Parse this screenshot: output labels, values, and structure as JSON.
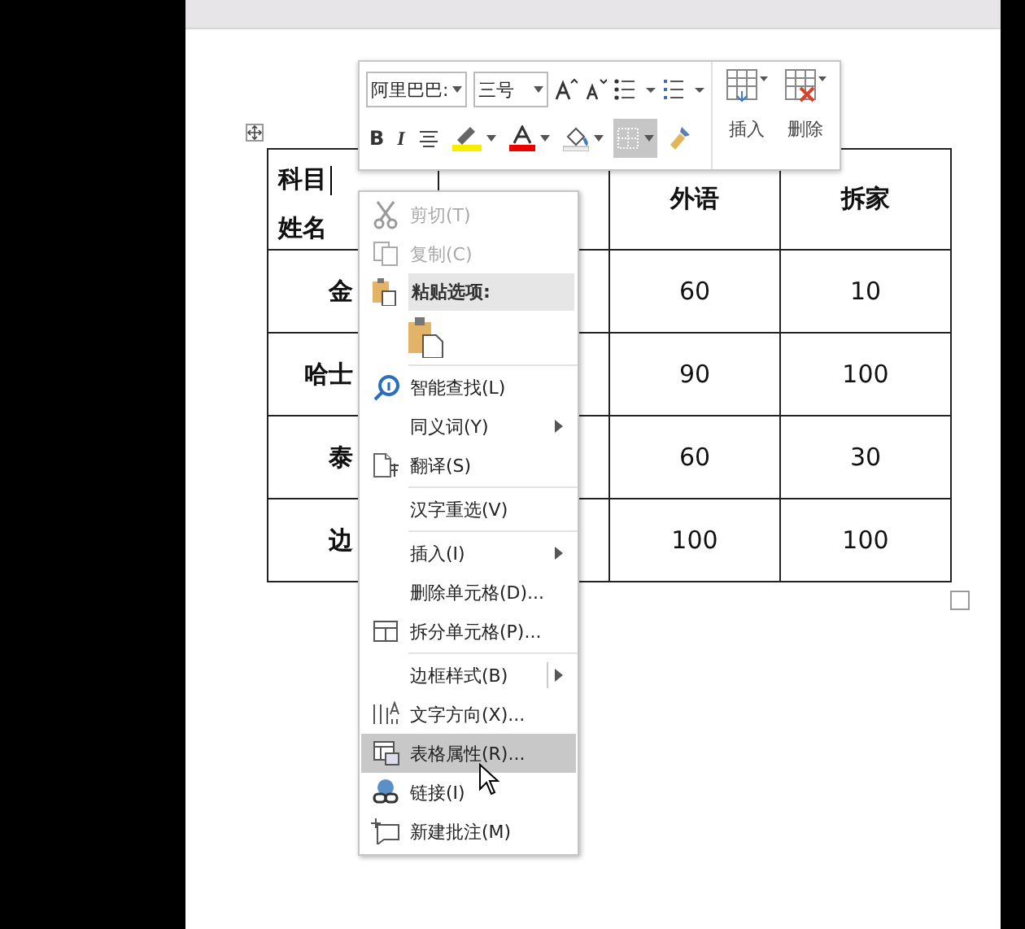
{
  "toolbar": {
    "font_name": "阿里巴巴:",
    "font_size": "三号",
    "format_buttons": [
      {
        "kind": "bold",
        "label": "B",
        "selected": false
      },
      {
        "kind": "italic",
        "label": "I",
        "selected": false
      },
      {
        "kind": "align",
        "selected": false
      },
      {
        "kind": "highlight",
        "selected": false
      },
      {
        "kind": "font-color",
        "selected": false
      },
      {
        "kind": "shading",
        "selected": false
      },
      {
        "kind": "borders",
        "selected": true
      },
      {
        "kind": "painter",
        "selected": false
      }
    ],
    "insert_label": "插入",
    "delete_label": "删除"
  },
  "table": {
    "corner_top": "科目",
    "corner_bottom": "姓名",
    "columns": [
      "外语",
      "拆家"
    ],
    "rows": [
      {
        "name": "金",
        "scores": [
          "60",
          "10"
        ]
      },
      {
        "name": "哈士",
        "scores": [
          "90",
          "100"
        ]
      },
      {
        "name": "泰",
        "scores": [
          "60",
          "30"
        ]
      },
      {
        "name": "边",
        "scores": [
          "100",
          "100"
        ]
      }
    ]
  },
  "context_menu": {
    "items": [
      {
        "kind": "cut",
        "label": "剪切(T)",
        "disabled": true,
        "selected": false
      },
      {
        "kind": "copy",
        "label": "复制(C)",
        "disabled": true,
        "selected": false
      },
      {
        "kind": "paste-header",
        "label": "粘贴选项:"
      },
      {
        "kind": "paste"
      },
      {
        "kind": "separator"
      },
      {
        "kind": "search",
        "label": "智能查找(L)",
        "disabled": false,
        "selected": false
      },
      {
        "kind": "submenu",
        "label": "同义词(Y)",
        "disabled": false,
        "selected": false
      },
      {
        "kind": "translate",
        "label": "翻译(S)",
        "disabled": false,
        "selected": false
      },
      {
        "kind": "separator"
      },
      {
        "kind": "plain",
        "label": "汉字重选(V)",
        "disabled": false,
        "selected": false
      },
      {
        "kind": "separator"
      },
      {
        "kind": "submenu",
        "label": "插入(I)",
        "disabled": false,
        "selected": false
      },
      {
        "kind": "plain",
        "label": "删除单元格(D)...",
        "disabled": false,
        "selected": false
      },
      {
        "kind": "split",
        "label": "拆分单元格(P)...",
        "disabled": false,
        "selected": false
      },
      {
        "kind": "separator"
      },
      {
        "kind": "split-submenu",
        "label": "边框样式(B)",
        "disabled": false,
        "selected": false
      },
      {
        "kind": "text-direction",
        "label": "文字方向(X)...",
        "disabled": false,
        "selected": false
      },
      {
        "kind": "table-properties",
        "label": "表格属性(R)...",
        "disabled": false,
        "selected": true
      },
      {
        "kind": "link",
        "label": "链接(I)",
        "disabled": false,
        "selected": false
      },
      {
        "kind": "comment",
        "label": "新建批注(M)",
        "disabled": false,
        "selected": false
      }
    ]
  }
}
